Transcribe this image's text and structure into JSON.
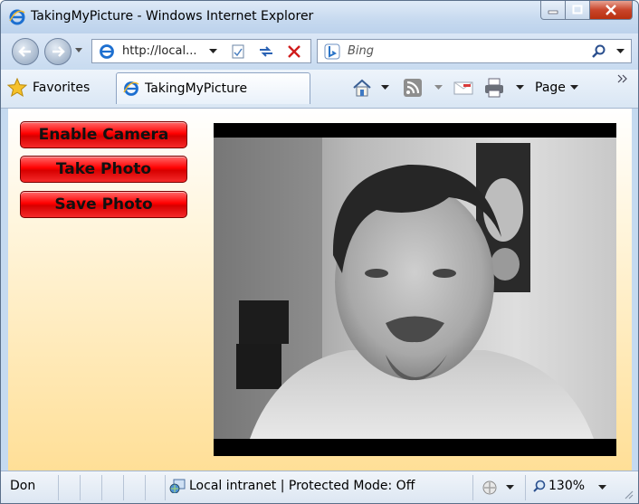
{
  "window": {
    "title": "TakingMyPicture - Windows Internet Explorer"
  },
  "nav": {
    "address": "http://local...",
    "search_placeholder": "Bing"
  },
  "favorites": {
    "label": "Favorites"
  },
  "tab": {
    "label": "TakingMyPicture"
  },
  "toolbar": {
    "page_label": "Page"
  },
  "app": {
    "buttons": [
      "Enable Camera",
      "Take Photo",
      "Save Photo"
    ]
  },
  "status": {
    "left_text": "Don",
    "zone_text": "Local intranet | Protected Mode: Off",
    "zoom_text": "130%"
  },
  "colors": {
    "button_red": "#ff0000",
    "content_gradient_end": "#ffdf97",
    "preview_bg": "#000000"
  }
}
